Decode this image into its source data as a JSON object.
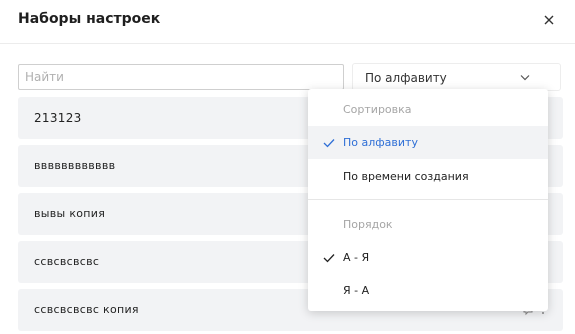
{
  "dialog": {
    "title": "Наборы настроек"
  },
  "search": {
    "placeholder": "Найти",
    "value": ""
  },
  "sort": {
    "selected": "По алфавиту"
  },
  "presets": [
    {
      "name": "213123"
    },
    {
      "name": "вввввввввввв"
    },
    {
      "name": "вывы копия"
    },
    {
      "name": "ссвсвсвсвс"
    },
    {
      "name": "ссвсвсвсвс копия"
    }
  ],
  "dropdown": {
    "sort_header": "Сортировка",
    "sort_options": [
      {
        "label": "По алфавиту",
        "checked": true
      },
      {
        "label": "По времени создания",
        "checked": false
      }
    ],
    "order_header": "Порядок",
    "order_options": [
      {
        "label": "А - Я",
        "checked": true
      },
      {
        "label": "Я - А",
        "checked": false
      }
    ]
  },
  "colors": {
    "accent": "#2f6fd6",
    "row_bg": "#f2f3f5"
  }
}
